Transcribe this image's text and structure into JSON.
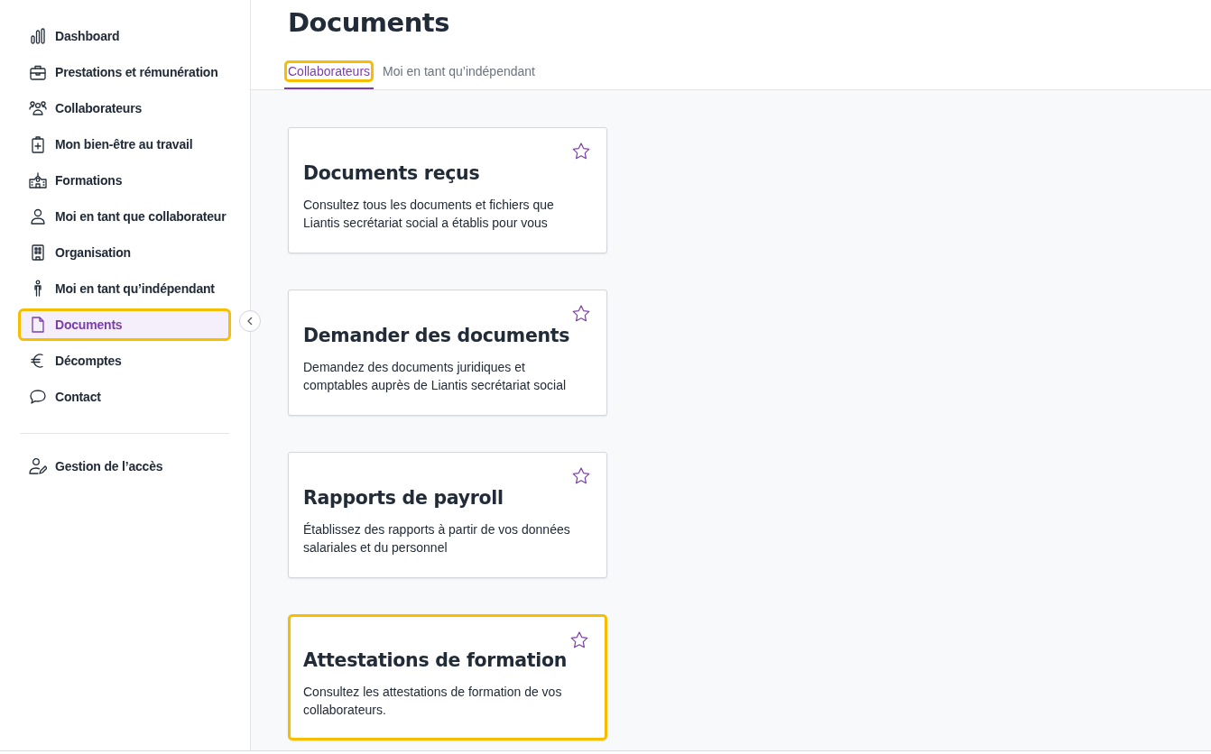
{
  "sidebar": {
    "items": [
      {
        "label": "Dashboard",
        "selected": false,
        "highlighted": false
      },
      {
        "label": "Prestations et rémunération",
        "selected": false,
        "highlighted": false
      },
      {
        "label": "Collaborateurs",
        "selected": false,
        "highlighted": false
      },
      {
        "label": "Mon bien-être au travail",
        "selected": false,
        "highlighted": false
      },
      {
        "label": "Formations",
        "selected": false,
        "highlighted": false
      },
      {
        "label": "Moi en tant que collaborateur",
        "selected": false,
        "highlighted": false
      },
      {
        "label": "Organisation",
        "selected": false,
        "highlighted": false
      },
      {
        "label": "Moi en tant qu’indépendant",
        "selected": false,
        "highlighted": false
      },
      {
        "label": "Documents",
        "selected": true,
        "highlighted": true
      },
      {
        "label": "Décomptes",
        "selected": false,
        "highlighted": false
      },
      {
        "label": "Contact",
        "selected": false,
        "highlighted": false
      }
    ],
    "footer_items": [
      {
        "label": "Gestion de l’accès",
        "selected": false,
        "highlighted": false
      }
    ]
  },
  "page": {
    "title": "Documents",
    "tabs": [
      {
        "label": "Collaborateurs",
        "selected": true,
        "highlighted": true
      },
      {
        "label": "Moi en tant qu’indépendant",
        "selected": false,
        "highlighted": false
      }
    ],
    "cards": [
      {
        "title": "Documents reçus",
        "description": "Consultez tous les documents et fichiers que Liantis secrétariat social a établis pour vous",
        "favorite": false,
        "highlighted": false
      },
      {
        "title": "Demander des documents",
        "description": "Demandez des documents juridiques et comptables auprès de Liantis secrétariat social",
        "favorite": false,
        "highlighted": false
      },
      {
        "title": "Rapports de payroll",
        "description": "Établissez des rapports à partir de vos données salariales et du personnel",
        "favorite": false,
        "highlighted": false
      },
      {
        "title": "Attestations de formation",
        "description": "Consultez les attestations de formation de vos collaborateurs.",
        "favorite": false,
        "highlighted": true
      }
    ]
  }
}
